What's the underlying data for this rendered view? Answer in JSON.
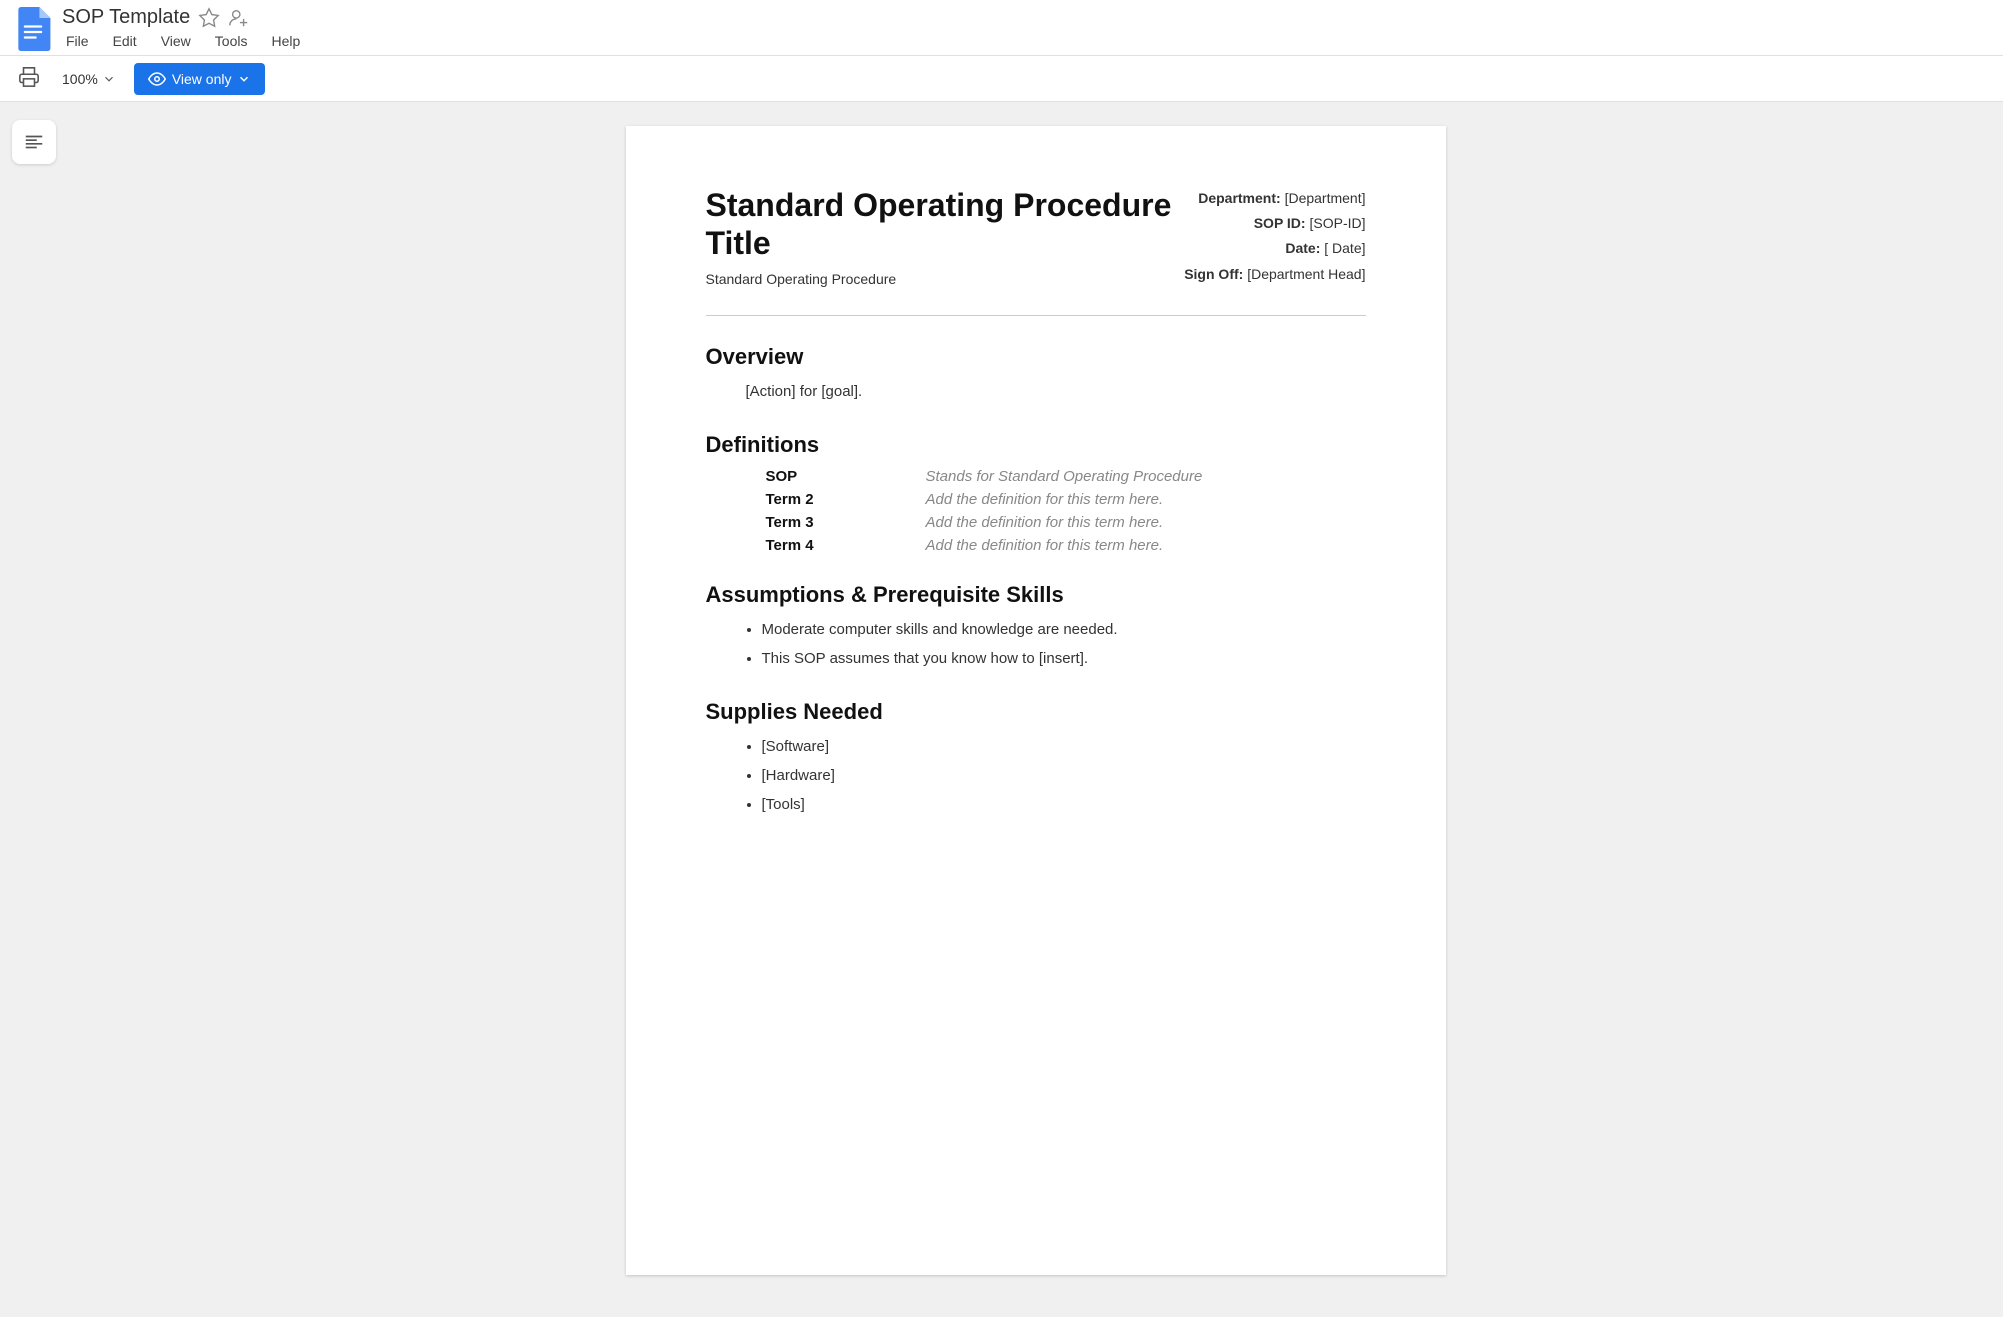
{
  "titlebar": {
    "doc_title": "SOP Template",
    "star_label": "star",
    "collab_label": "add-collaborator",
    "menu_items": [
      "File",
      "Edit",
      "View",
      "Tools",
      "Help"
    ]
  },
  "toolbar": {
    "print_label": "print",
    "zoom_value": "100%",
    "zoom_icon": "▾",
    "view_only_label": "View only",
    "view_only_icon": "👁"
  },
  "sidebar": {
    "outline_icon_label": "outline"
  },
  "document": {
    "main_title": "Standard Operating Procedure Title",
    "subtitle": "Standard Operating Procedure",
    "meta": {
      "department_label": "Department:",
      "department_value": "[Department]",
      "sop_id_label": "SOP ID:",
      "sop_id_value": "[SOP-ID]",
      "date_label": "Date:",
      "date_value": "[ Date]",
      "signoff_label": "Sign Off:",
      "signoff_value": "[Department Head]"
    },
    "sections": [
      {
        "id": "overview",
        "title": "Overview",
        "body_text": "[Action] for [goal].",
        "type": "text"
      },
      {
        "id": "definitions",
        "title": "Definitions",
        "type": "definitions",
        "items": [
          {
            "term": "SOP",
            "value": "Stands for Standard Operating Procedure"
          },
          {
            "term": "Term 2",
            "value": "Add the definition for this term here."
          },
          {
            "term": "Term 3",
            "value": "Add the definition for this term here."
          },
          {
            "term": "Term 4",
            "value": "Add the definition for this term here."
          }
        ]
      },
      {
        "id": "assumptions",
        "title": "Assumptions & Prerequisite Skills",
        "type": "bullets",
        "items": [
          "Moderate computer skills and knowledge are needed.",
          "This SOP assumes that you know how to [insert]."
        ]
      },
      {
        "id": "supplies",
        "title": "Supplies Needed",
        "type": "bullets",
        "items": [
          "[Software]",
          "[Hardware]",
          "[Tools]"
        ]
      }
    ]
  }
}
